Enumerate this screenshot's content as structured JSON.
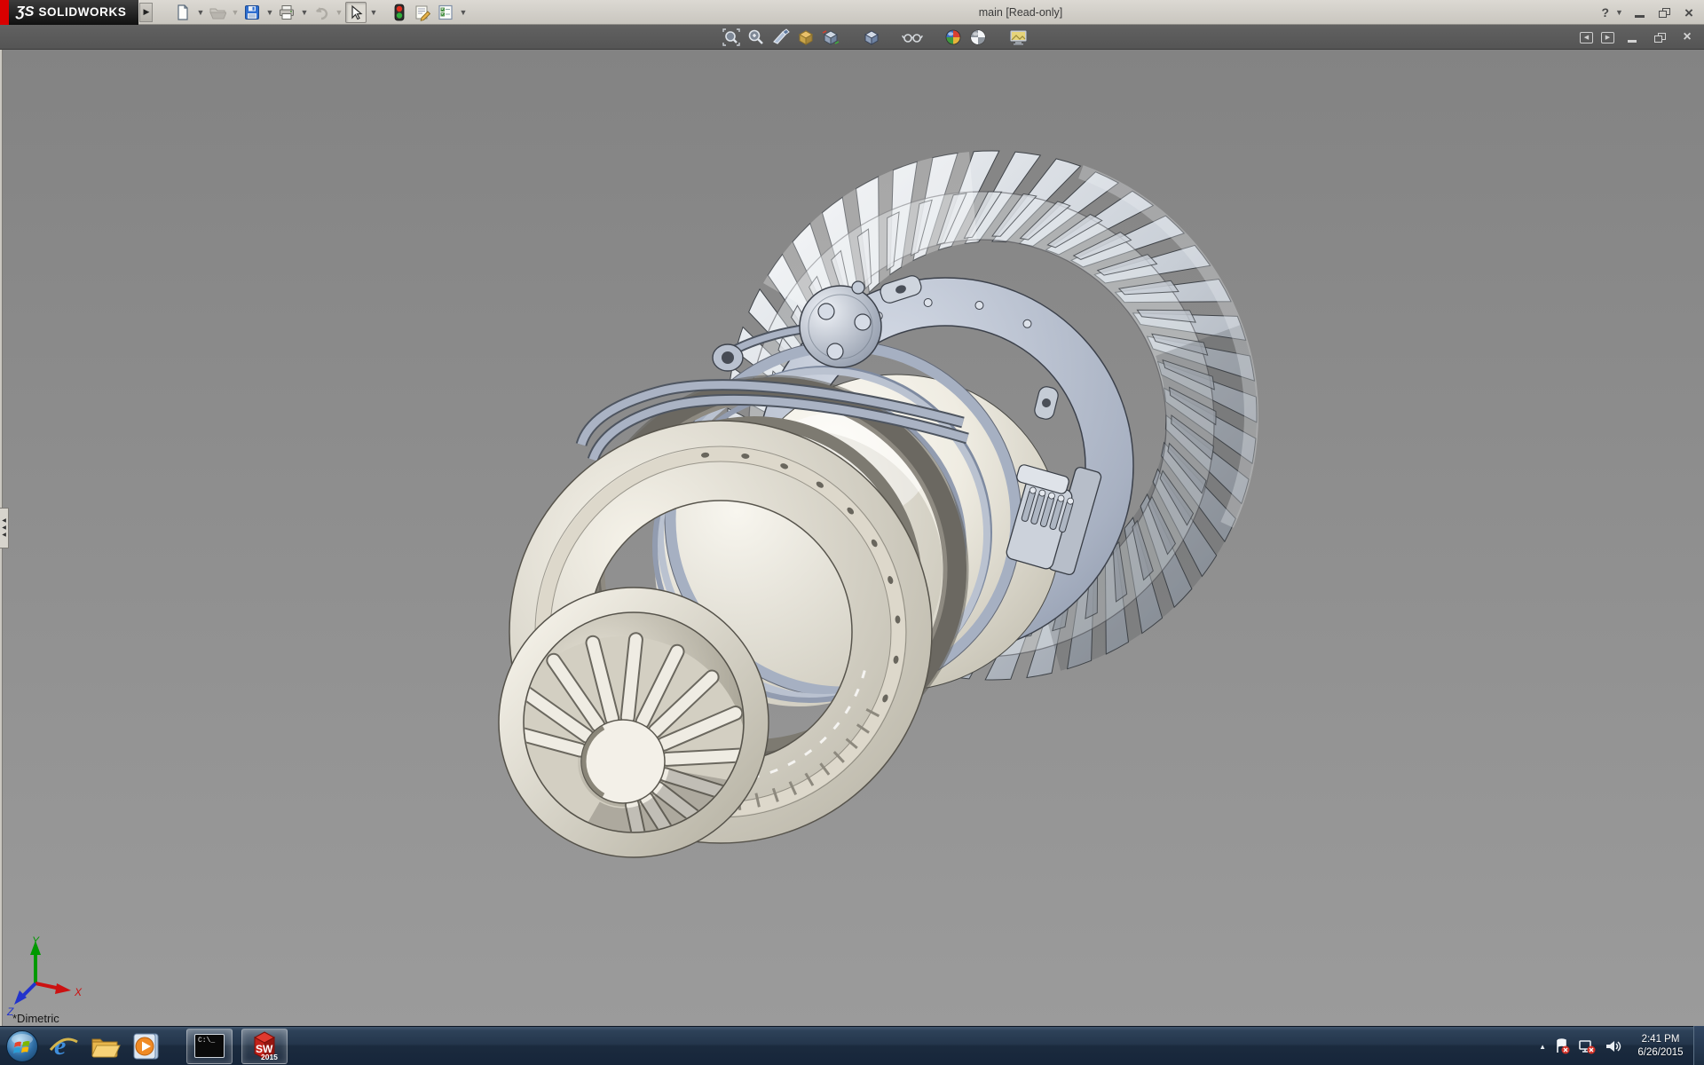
{
  "titlebar": {
    "brand_prefix": "ƷS",
    "brand": "SOLIDWORKS",
    "title": "main [Read-only]",
    "help": "?",
    "close_glyph": "×",
    "tools": [
      {
        "name": "new",
        "icon": "new-document-icon"
      },
      {
        "name": "open",
        "icon": "open-folder-icon",
        "disabled": true
      },
      {
        "name": "save",
        "icon": "save-floppy-icon"
      },
      {
        "name": "print",
        "icon": "printer-icon"
      },
      {
        "name": "undo",
        "icon": "undo-arrow-icon",
        "disabled": true
      },
      {
        "name": "select",
        "icon": "cursor-arrow-icon",
        "pressed": true
      },
      {
        "name": "rebuild",
        "icon": "traffic-light-icon"
      },
      {
        "name": "file-properties",
        "icon": "sheet-pencil-icon"
      },
      {
        "name": "options",
        "icon": "checklist-icon"
      }
    ]
  },
  "headsup_toolbar": {
    "items": [
      "zoom-to-fit",
      "zoom-to-area",
      "section-view",
      "view-orientation",
      "display-style",
      "view-cube",
      "hide-show-items",
      "edit-appearance",
      "apply-scene",
      "view-settings"
    ]
  },
  "viewport": {
    "orientation": "*Dimetric",
    "triad": {
      "x": "X",
      "y": "Y",
      "z": "Z",
      "x_color": "#cc1111",
      "y_color": "#009900",
      "z_color": "#2233cc"
    },
    "background": {
      "top": "#838383",
      "bottom": "#9b9b9b"
    },
    "model": {
      "blade_stroke": "#3f4348",
      "steel_stroke": "#3c414b",
      "bolt_fill": "#dde2ea",
      "flute_light": "#efece3",
      "flute_dark": "#6b685f",
      "flange_hole": "#55524a",
      "tick_color": "#8d897e"
    }
  },
  "taskbar": {
    "items": [
      {
        "name": "start"
      },
      {
        "name": "internet-explorer"
      },
      {
        "name": "file-explorer"
      },
      {
        "name": "media-player"
      },
      {
        "name": "command-prompt",
        "label": "C:\\_",
        "active": true
      },
      {
        "name": "solidworks-2015",
        "label": "SW",
        "year": "2015",
        "active": true
      }
    ],
    "tray": {
      "time": "2:41 PM",
      "date": "6/26/2015"
    }
  }
}
